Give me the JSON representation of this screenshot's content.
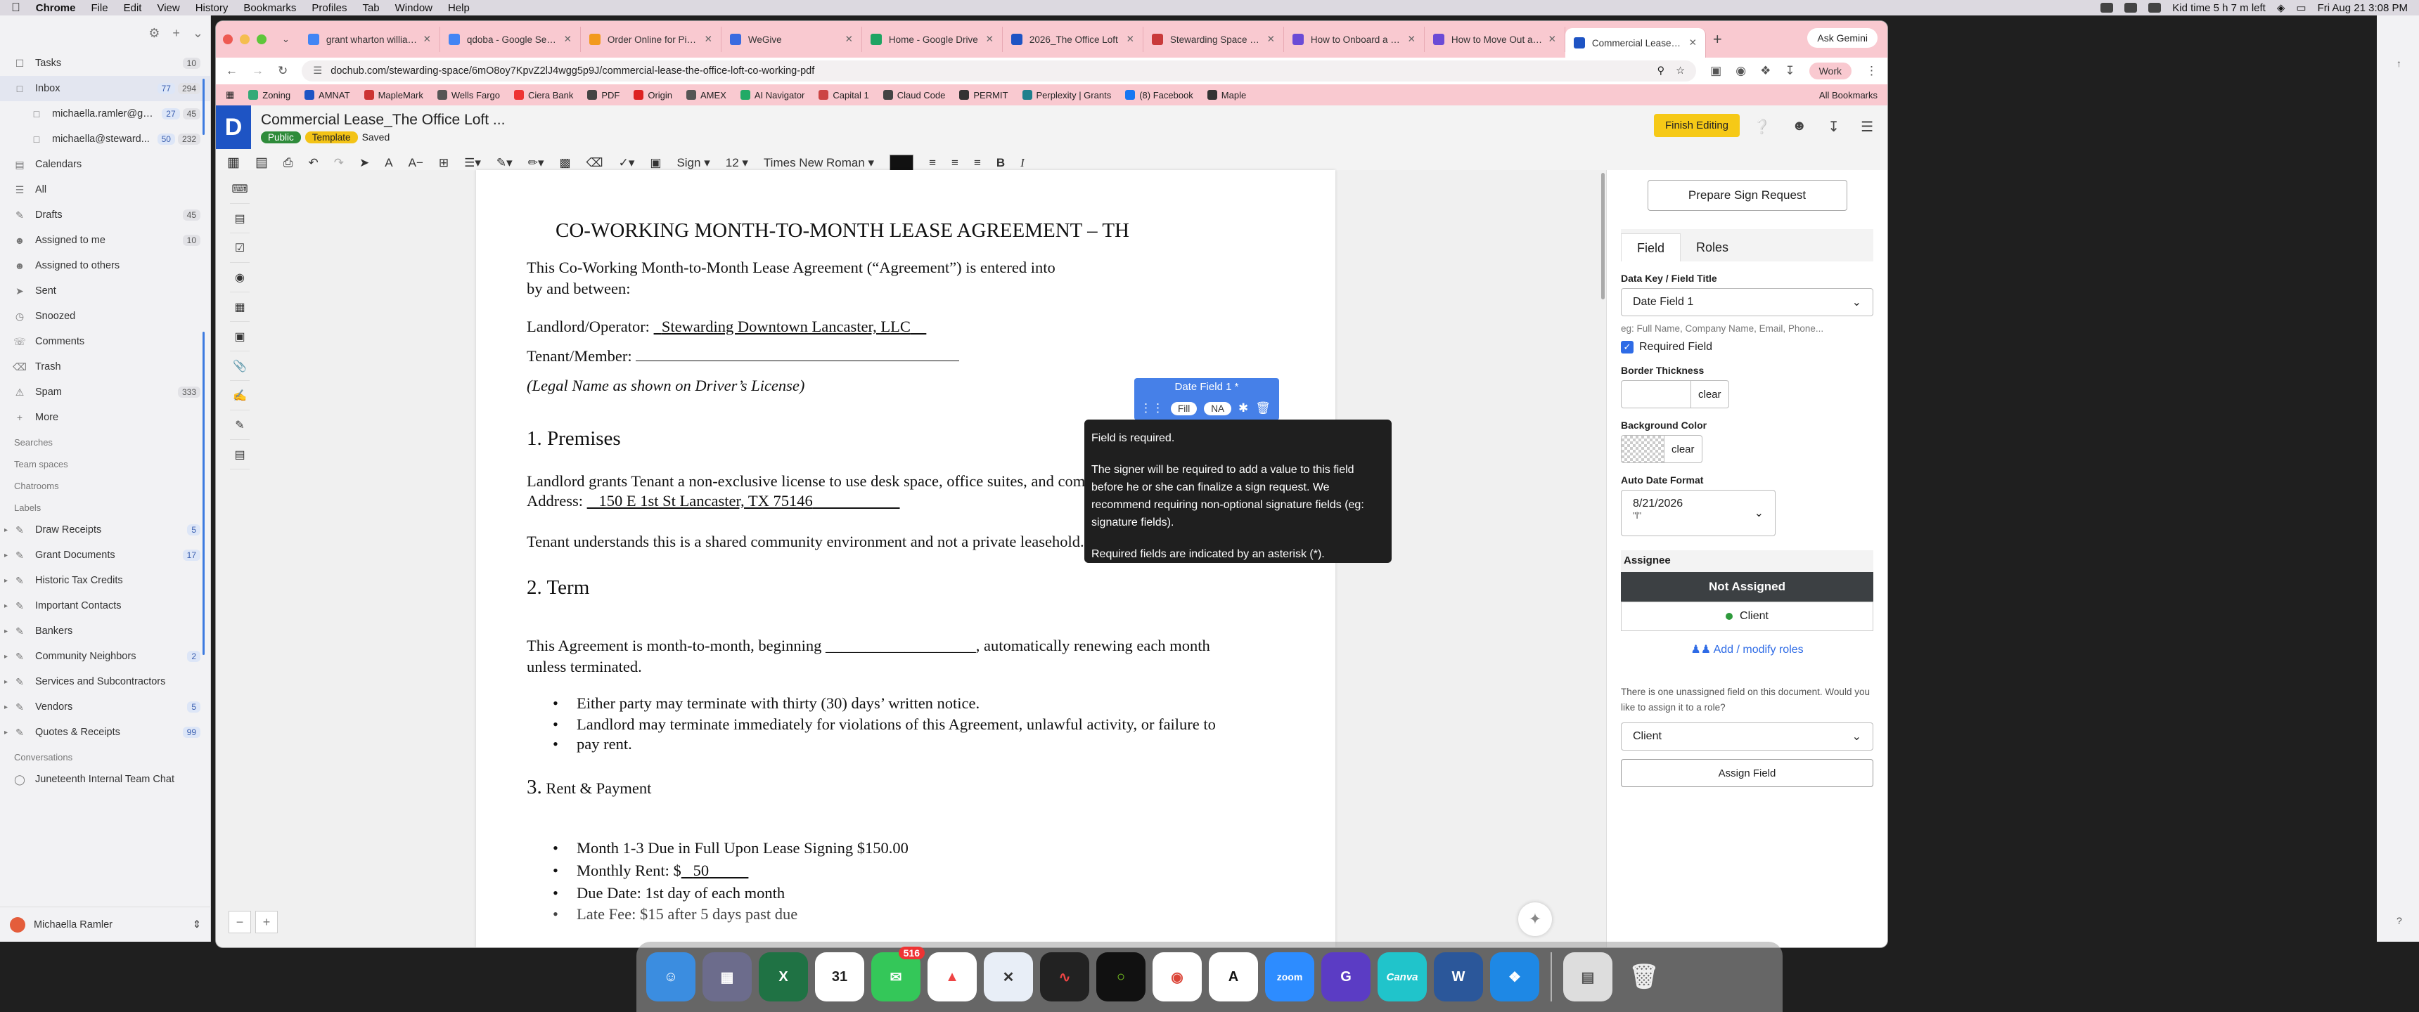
{
  "menubar": {
    "app": "Chrome",
    "items": [
      "File",
      "Edit",
      "View",
      "History",
      "Bookmarks",
      "Profiles",
      "Tab",
      "Window",
      "Help"
    ],
    "kid_time": "Kid time 5 h 7 m left",
    "datetime": "Fri Aug 21  3:08 PM"
  },
  "leftapp": {
    "nav": [
      {
        "label": "Tasks",
        "count": "10"
      },
      {
        "label": "Inbox",
        "count": "77",
        "count2": "294",
        "selected": true
      },
      {
        "label": "michaella.ramler@gm...",
        "count": "27",
        "count2": "45",
        "sub": true
      },
      {
        "label": "michaella@steward...",
        "count": "50",
        "count2": "232",
        "sub": true
      },
      {
        "label": "Calendars"
      },
      {
        "label": "All"
      },
      {
        "label": "Drafts",
        "count": "45"
      },
      {
        "label": "Assigned to me",
        "count": "10"
      },
      {
        "label": "Assigned to others"
      },
      {
        "label": "Sent"
      },
      {
        "label": "Snoozed"
      },
      {
        "label": "Comments"
      },
      {
        "label": "Trash"
      },
      {
        "label": "Spam",
        "count": "333"
      },
      {
        "label": "More"
      }
    ],
    "sections": {
      "searches": "Searches",
      "team_spaces": "Team spaces",
      "chatrooms": "Chatrooms",
      "labels": "Labels",
      "conversations": "Conversations"
    },
    "labels": [
      {
        "label": "Draw Receipts",
        "count": "5"
      },
      {
        "label": "Grant Documents",
        "count": "17"
      },
      {
        "label": "Historic Tax Credits"
      },
      {
        "label": "Important Contacts"
      },
      {
        "label": "Bankers"
      },
      {
        "label": "Community Neighbors",
        "count": "2"
      },
      {
        "label": "Services and Subcontractors"
      },
      {
        "label": "Vendors",
        "count": "5"
      },
      {
        "label": "Quotes & Receipts",
        "count": "99"
      }
    ],
    "conversations": [
      {
        "label": "Juneteenth Internal Team Chat"
      }
    ],
    "user": "Michaella Ramler"
  },
  "browser": {
    "tabs": [
      {
        "title": "grant wharton williams",
        "color": "#4285f4"
      },
      {
        "title": "qdoba - Google Search",
        "color": "#4285f4"
      },
      {
        "title": "Order Online for Pickup",
        "color": "#f29a1d"
      },
      {
        "title": "WeGive",
        "color": "#3a6be0"
      },
      {
        "title": "Home - Google Drive",
        "color": "#1fa463"
      },
      {
        "title": "2026_The Office Loft",
        "color": "#1e54c4"
      },
      {
        "title": "Stewarding Space — S",
        "color": "#c93a3a"
      },
      {
        "title": "How to Onboard a New",
        "color": "#6b4bd6"
      },
      {
        "title": "How to Move Out a Te",
        "color": "#6b4bd6"
      },
      {
        "title": "Commercial Lease_The",
        "color": "#1e54c4",
        "active": true
      }
    ],
    "ask_gemini": "Ask Gemini",
    "url": "dochub.com/stewarding-space/6mO8oy7KpvZ2lJ4wgg5p9J/commercial-lease-the-office-loft-co-working-pdf",
    "profile": "Work",
    "bookmarks": [
      "Zoning",
      "AMNAT",
      "MapleMark",
      "Wells Fargo",
      "Ciera Bank",
      "PDF",
      "Origin",
      "AMEX",
      "AI Navigator",
      "Capital 1",
      "Claud Code",
      "PERMIT",
      "Perplexity | Grants",
      "(8) Facebook",
      "Maple"
    ],
    "all_bookmarks": "All Bookmarks"
  },
  "doc": {
    "title": "Commercial Lease_The Office Loft ...",
    "badge_public": "Public",
    "badge_template": "Template",
    "saved": "Saved",
    "finish_editing": "Finish Editing",
    "logo": "D",
    "toolbar": {
      "sign": "Sign",
      "size": "12",
      "font": "Times New Roman"
    }
  },
  "page": {
    "title": "CO-WORKING MONTH-TO-MONTH LEASE AGREEMENT – TH",
    "intro1": "This Co-Working Month-to-Month Lease Agreement (“Agreement”) is entered into",
    "intro2": "by and between:",
    "landlord_label": "Landlord/Operator:",
    "landlord_value": "Stewarding Downtown Lancaster, LLC",
    "tenant_label": "Tenant/Member:",
    "legal_name": "(Legal Name as shown on Driver’s License)",
    "s1": "1. Premises",
    "s1_text": "Landlord grants Tenant a non-exclusive license to use desk space, office suites, and common areas within:",
    "address_label": "Address:",
    "address_value": "150 E 1st St Lancaster, TX 75146",
    "s1_text2": "Tenant understands this is a shared community environment and not a private leasehold.",
    "s2": "2. Term",
    "s2_text1": "This Agreement is month-to-month, beginning ___________________, automatically renewing each month",
    "s2_text2": "unless terminated.",
    "b1": "Either party may terminate with thirty (30) days’ written notice.",
    "b2a": "Landlord may terminate immediately for violations of this Agreement, unlawful activity, or failure to",
    "b2b": "pay rent.",
    "s3_num": "3.",
    "s3": "Rent & Payment",
    "b3": "Month 1-3 Due in Full Upon Lease Signing $150.00",
    "b4_label": "Monthly Rent: $",
    "b4_value": "50",
    "b5": "Due Date: 1st day of each month",
    "b6": "Late Fee: $15 after 5 days past due"
  },
  "datefield": {
    "title": "Date Field 1 *",
    "fill": "Fill",
    "na": "NA"
  },
  "tooltip": {
    "line1": "Field is required.",
    "line2": "The signer will be required to add a value to this field before he or she can finalize a sign request. We recommend requiring non-optional signature fields (eg: signature fields).",
    "line3": "Required fields are indicated by an asterisk (*)."
  },
  "panel": {
    "prepare": "Prepare Sign Request",
    "tab_field": "Field",
    "tab_roles": "Roles",
    "datakey_label": "Data Key / Field Title",
    "datakey_value": "Date Field 1",
    "datakey_hint": "eg: Full Name, Company Name, Email, Phone...",
    "required": "Required Field",
    "border_label": "Border Thickness",
    "clear": "clear",
    "bg_label": "Background Color",
    "autodate_label": "Auto Date Format",
    "autodate_value": "8/21/2026",
    "autodate_sub": "\"l\"",
    "assignee": "Assignee",
    "not_assigned": "Not Assigned",
    "client": "Client",
    "add_roles": "Add / modify roles",
    "note": "There is one unassigned field on this document. Would you like to assign it to a role?",
    "role_select": "Client",
    "assign_field": "Assign Field"
  },
  "dock": {
    "messages_badge": "516",
    "zoom": "zoom",
    "canva": "Canva",
    "calendar_day": "31"
  }
}
